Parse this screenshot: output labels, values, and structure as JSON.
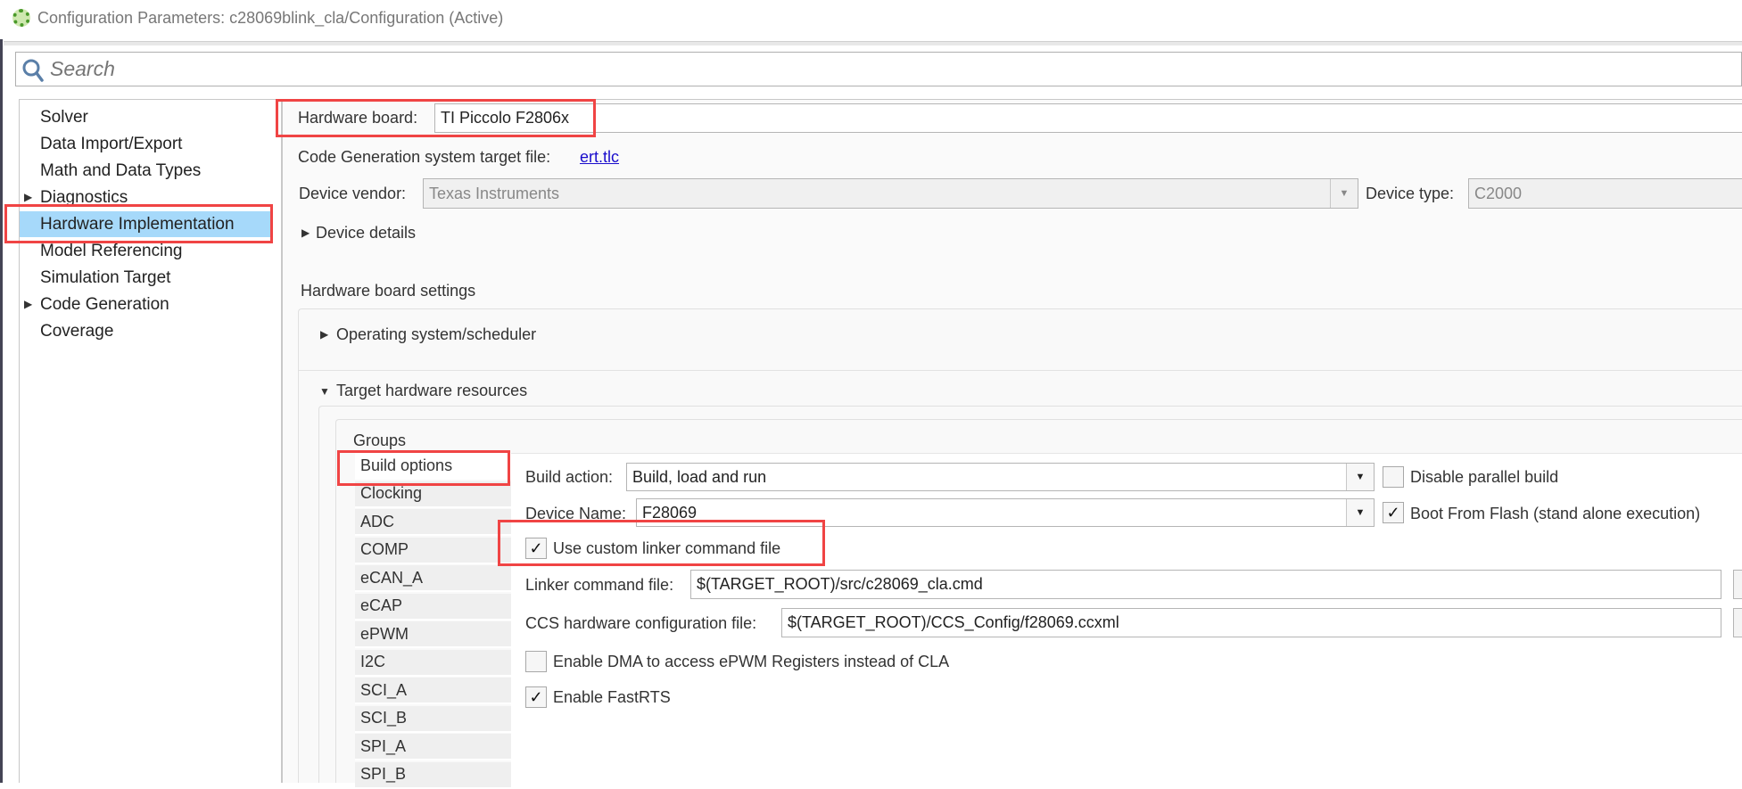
{
  "window": {
    "title": "Configuration Parameters: c28069blink_cla/Configuration (Active)",
    "app_icon": "gear-icon"
  },
  "search": {
    "placeholder": "Search"
  },
  "tree": {
    "items": [
      {
        "label": "Solver",
        "expandable": false
      },
      {
        "label": "Data Import/Export",
        "expandable": false
      },
      {
        "label": "Math and Data Types",
        "expandable": false
      },
      {
        "label": "Diagnostics",
        "expandable": true
      },
      {
        "label": "Hardware Implementation",
        "expandable": false,
        "selected": true
      },
      {
        "label": "Model Referencing",
        "expandable": false
      },
      {
        "label": "Simulation Target",
        "expandable": false
      },
      {
        "label": "Code Generation",
        "expandable": true
      },
      {
        "label": "Coverage",
        "expandable": false
      }
    ]
  },
  "main": {
    "hardware_board_label": "Hardware board:",
    "hardware_board_value": "TI Piccolo F2806x",
    "codegen_label": "Code Generation system target file:",
    "codegen_link": "ert.tlc",
    "device_vendor_label": "Device vendor:",
    "device_vendor_value": "Texas Instruments",
    "device_type_label": "Device type:",
    "device_type_value": "C2000",
    "device_details": "Device details",
    "hw_settings_title": "Hardware board settings",
    "os_scheduler": "Operating system/scheduler",
    "target_resources": "Target hardware resources",
    "groups_label": "Groups",
    "groups": [
      "Build options",
      "Clocking",
      "ADC",
      "COMP",
      "eCAN_A",
      "eCAP",
      "ePWM",
      "I2C",
      "SCI_A",
      "SCI_B",
      "SPI_A",
      "SPI_B"
    ],
    "build_action_label": "Build action:",
    "build_action_value": "Build, load and run",
    "disable_parallel_label": "Disable parallel build",
    "disable_parallel_checked": false,
    "device_name_label": "Device Name:",
    "device_name_value": "F28069",
    "boot_flash_label": "Boot From Flash (stand alone execution)",
    "boot_flash_checked": true,
    "custom_linker_label": "Use custom linker command file",
    "custom_linker_checked": true,
    "linker_file_label": "Linker command file:",
    "linker_file_value": "$(TARGET_ROOT)/src/c28069_cla.cmd",
    "ccs_label": "CCS hardware configuration file:",
    "ccs_value": "$(TARGET_ROOT)/CCS_Config/f28069.ccxml",
    "dma_label": "Enable DMA to access ePWM Registers instead of CLA",
    "dma_checked": false,
    "fastrts_label": "Enable FastRTS",
    "fastrts_checked": true
  },
  "colors": {
    "highlight": "#a6d9fa",
    "annotation": "#f04444",
    "link": "#1a0dcc"
  }
}
